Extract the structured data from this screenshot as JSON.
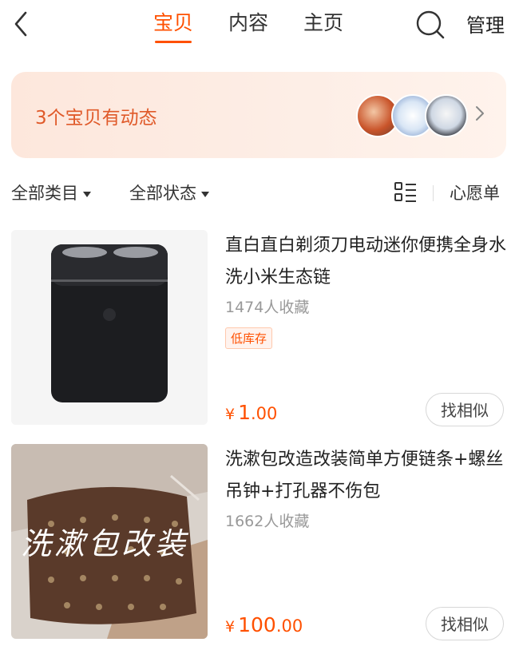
{
  "header": {
    "tabs": [
      {
        "label": "宝贝",
        "active": true
      },
      {
        "label": "内容",
        "active": false
      },
      {
        "label": "主页",
        "active": false
      }
    ],
    "manage_label": "管理",
    "accent_color": "#ff5000"
  },
  "banner": {
    "text": "3个宝贝有动态"
  },
  "filters": {
    "category_label": "全部类目",
    "status_label": "全部状态",
    "wishlist_label": "心愿单"
  },
  "products": [
    {
      "title": "直白直白剃须刀电动迷你便携全身水洗小米生态链",
      "favorites": "1474人收藏",
      "badge": "低库存",
      "price_symbol": "¥",
      "price_int": "1",
      "price_dec": ".00",
      "similar_label": "找相似"
    },
    {
      "title": "洗漱包改造改装简单方便链条+螺丝吊钟+打孔器不伤包",
      "favorites": "1662人收藏",
      "image_caption": "洗漱包改装",
      "price_symbol": "¥",
      "price_int": "100",
      "price_dec": ".00",
      "similar_label": "找相似"
    }
  ]
}
